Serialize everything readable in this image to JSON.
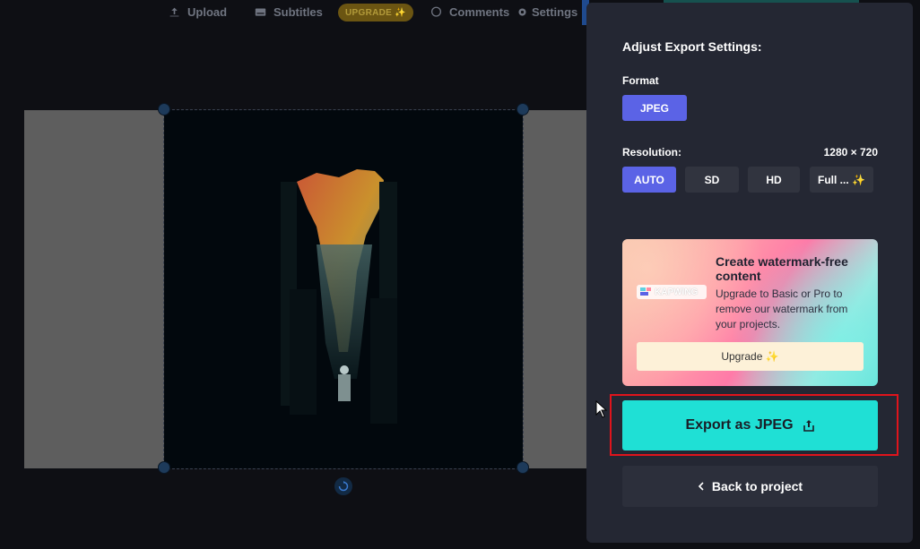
{
  "topbar": {
    "upload_label": "Upload",
    "subtitles_label": "Subtitles",
    "upgrade_label": "UPGRADE ✨",
    "comments_label": "Comments",
    "settings_label": "Settings"
  },
  "panel": {
    "title": "Adjust Export Settings:",
    "format_label": "Format",
    "format_value": "JPEG",
    "resolution_label": "Resolution:",
    "resolution_value": "1280 × 720",
    "resolution_options": [
      "AUTO",
      "SD",
      "HD",
      "Full ... ✨"
    ],
    "resolution_selected": "AUTO"
  },
  "promo": {
    "logo_text": "KAPWING",
    "title": "Create watermark-free content",
    "body": "Upgrade to Basic or Pro to remove our watermark from your projects.",
    "button_label": "Upgrade ✨"
  },
  "actions": {
    "export_label": "Export as JPEG",
    "back_label": "Back to project"
  },
  "colors": {
    "accent": "#5b63e6",
    "export": "#1fe0d5",
    "highlight": "#e0141c",
    "panel_bg": "#242733"
  }
}
